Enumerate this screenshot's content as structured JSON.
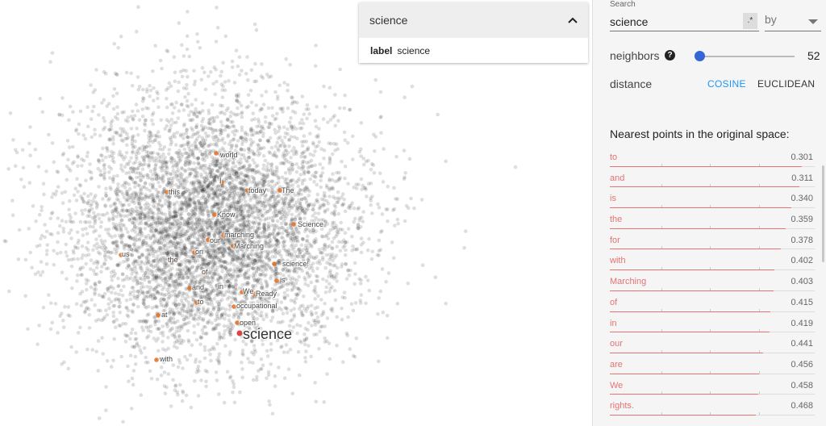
{
  "projection": {
    "selected_word": "science",
    "labels": [
      "world",
      "I",
      "this",
      "today",
      "The",
      "Know",
      "Science",
      "our",
      "marching",
      "Marching",
      "us",
      "the",
      "on",
      "science!",
      "of",
      "is",
      "and",
      "in",
      "We",
      "Ready",
      "to",
      "occupational",
      "at",
      "open",
      "with"
    ]
  },
  "search_card": {
    "title": "science",
    "label_key": "label",
    "label_value": "science"
  },
  "panel": {
    "search_caption": "Search",
    "search_value": "science",
    "regex_toggle": ".*",
    "by_select": "by",
    "neighbors_label": "neighbors",
    "neighbors_value": "52",
    "neighbors_fraction": 0.0,
    "distance_label": "distance",
    "cosine_label": "COSINE",
    "euclidean_label": "EUCLIDEAN",
    "nearest_title": "Nearest points in the original space:",
    "nearest": [
      {
        "word": "to",
        "dist": "0.301"
      },
      {
        "word": "and",
        "dist": "0.311"
      },
      {
        "word": "is",
        "dist": "0.340"
      },
      {
        "word": "the",
        "dist": "0.359"
      },
      {
        "word": "for",
        "dist": "0.378"
      },
      {
        "word": "with",
        "dist": "0.402"
      },
      {
        "word": "Marching",
        "dist": "0.403"
      },
      {
        "word": "of",
        "dist": "0.415"
      },
      {
        "word": "in",
        "dist": "0.419"
      },
      {
        "word": "our",
        "dist": "0.441"
      },
      {
        "word": "are",
        "dist": "0.456"
      },
      {
        "word": "We",
        "dist": "0.458"
      },
      {
        "word": "rights.",
        "dist": "0.468"
      }
    ]
  },
  "colors": {
    "accent": "#2196f3",
    "neighbor_red": "#e57373",
    "slider_blue": "#3367d6",
    "point_orange": "#e07020"
  }
}
